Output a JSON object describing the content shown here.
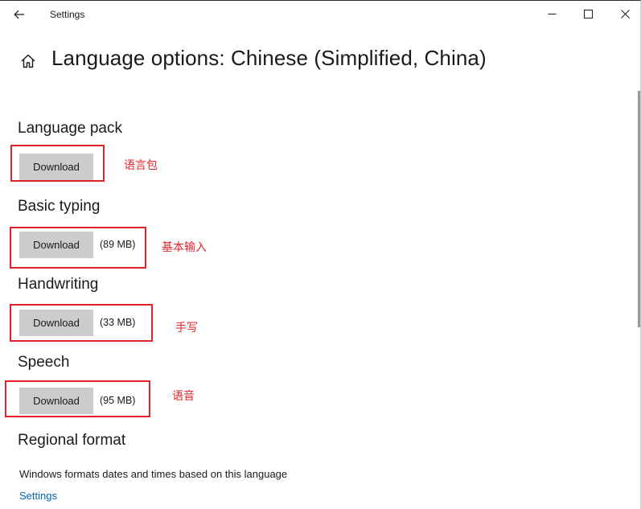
{
  "window": {
    "title": "Settings"
  },
  "header": {
    "page_title": "Language options: Chinese (Simplified, China)"
  },
  "sections": [
    {
      "heading": "Language pack",
      "button_label": "Download",
      "size": "",
      "annotation": "语言包"
    },
    {
      "heading": "Basic typing",
      "button_label": "Download",
      "size": "(89 MB)",
      "annotation": "基本输入"
    },
    {
      "heading": "Handwriting",
      "button_label": "Download",
      "size": "(33 MB)",
      "annotation": "手写"
    },
    {
      "heading": "Speech",
      "button_label": "Download",
      "size": "(95 MB)",
      "annotation": "语音"
    }
  ],
  "regional": {
    "heading": "Regional format",
    "description": "Windows formats dates and times based on this language",
    "link": "Settings"
  },
  "colors": {
    "annotation_red": "#e0242a",
    "button_gray": "#cccccc",
    "link_blue": "#0067b8"
  },
  "icons": {
    "back": "back-arrow-icon",
    "home": "home-icon",
    "minimize": "minimize-icon",
    "maximize": "maximize-icon",
    "close": "close-icon"
  }
}
